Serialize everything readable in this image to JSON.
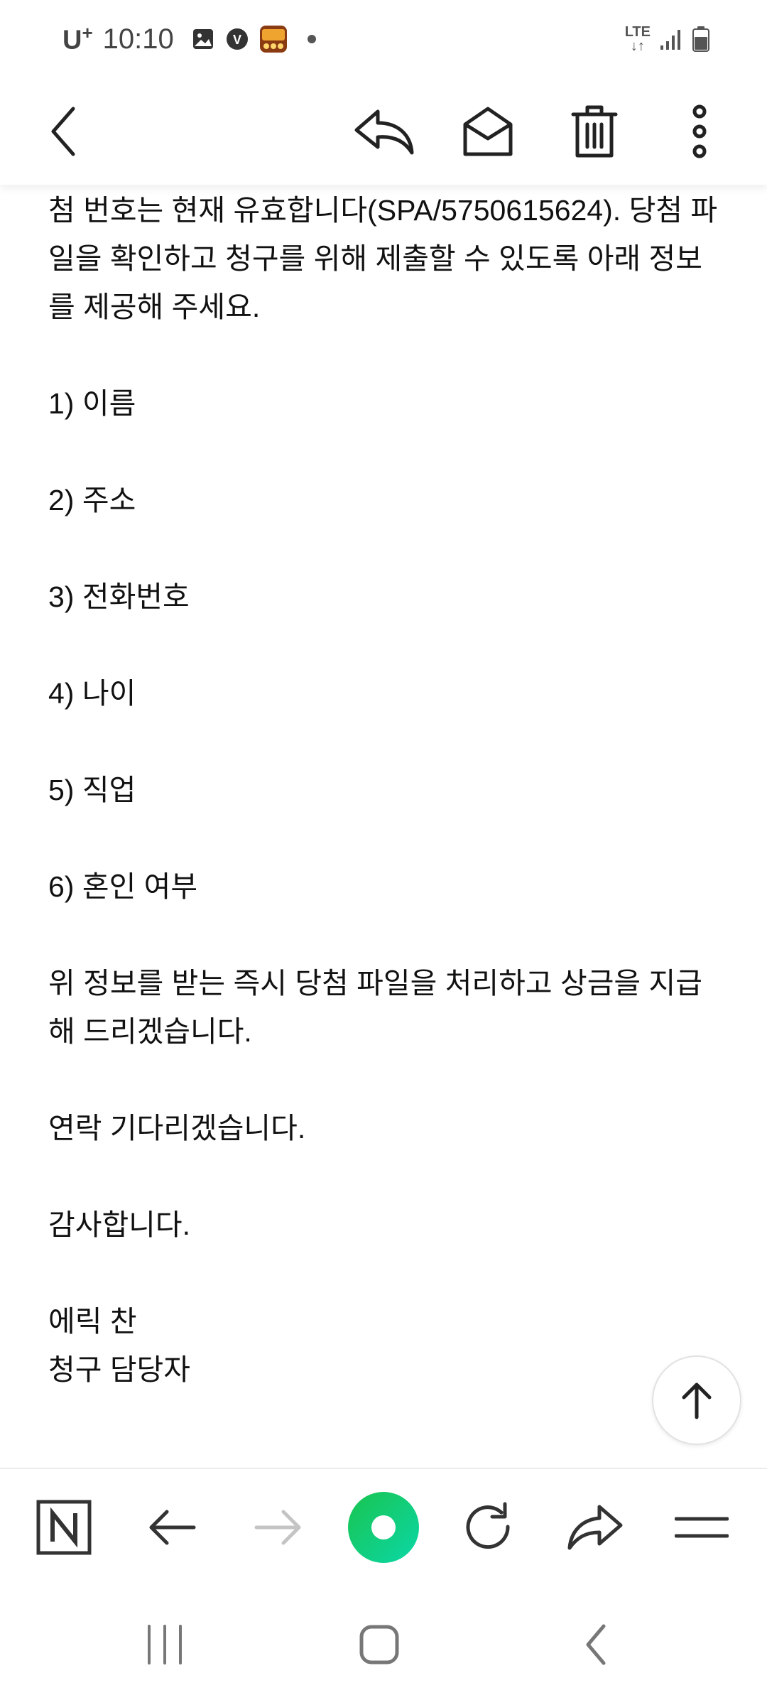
{
  "status_bar": {
    "carrier": "U",
    "carrier_sup": "+",
    "time": "10:10",
    "network": "LTE"
  },
  "toolbar": {
    "icons": [
      "back-icon",
      "reply-icon",
      "mark-unread-icon",
      "delete-icon",
      "more-icon"
    ]
  },
  "email": {
    "lines": [
      "첨 번호는 현재 유효합니다(SPA/5750615624). 당첨 파일을 확인하고 청구를 위해 제출할 수 있도록 아래 정보를 제공해 주세요.",
      "1) 이름",
      "2) 주소",
      "3) 전화번호",
      "4) 나이",
      "5) 직업",
      "6) 혼인 여부",
      "위 정보를 받는 즉시 당첨 파일을 처리하고 상금을 지급해 드리겠습니다.",
      "연락 기다리겠습니다.",
      "감사합니다.",
      "에릭 찬",
      "청구 담당자"
    ]
  },
  "browser_bar": {
    "icons": [
      "naver-home-icon",
      "back-arrow-icon",
      "forward-arrow-icon",
      "green-dot-icon",
      "refresh-icon",
      "share-icon",
      "menu-icon"
    ],
    "accent": "#03c75a"
  },
  "nav_bar": {
    "icons": [
      "recents-icon",
      "home-icon",
      "back-icon"
    ]
  }
}
